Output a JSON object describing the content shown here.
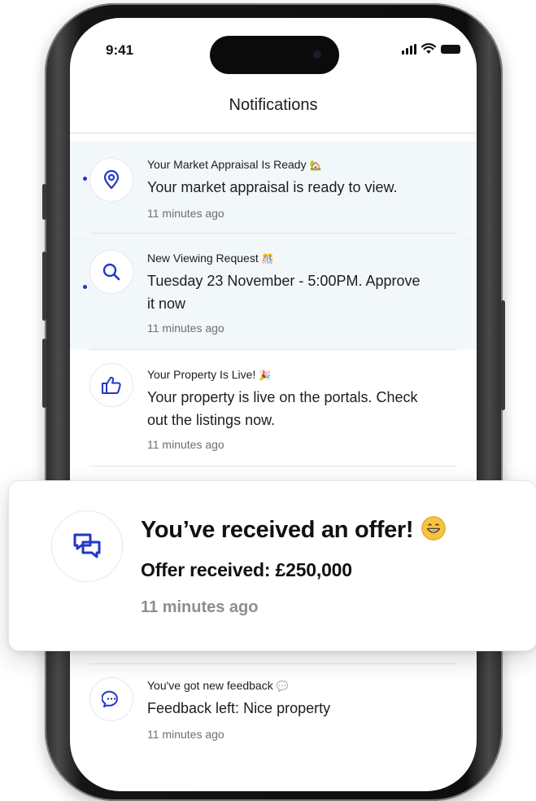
{
  "status_bar": {
    "time": "9:41"
  },
  "header": {
    "title": "Notifications"
  },
  "notifications": [
    {
      "title": "Your Market Appraisal Is Ready",
      "title_emoji": "🏡",
      "body": "Your market appraisal is ready to view.",
      "time": "11 minutes ago",
      "icon": "location-pin-icon",
      "unread": true
    },
    {
      "title": "New Viewing Request",
      "title_emoji": "🎊",
      "body_line1": "Tuesday 23 November - 5:00PM. Approve",
      "body_line2": "it now",
      "time": "11 minutes ago",
      "icon": "search-icon",
      "unread": true
    },
    {
      "title": "Your Property Is Live!",
      "title_emoji": "🎉",
      "body_line1": "Your property is live on the portals. Check",
      "body_line2": "out the listings now.",
      "time": "11 minutes ago",
      "icon": "thumbs-up-icon",
      "unread": false
    },
    {
      "title": "You've got new feedback",
      "title_emoji": "💬",
      "body": "Feedback left: Nice property",
      "time": "11 minutes ago",
      "icon": "chat-bubble-icon",
      "unread": false
    }
  ],
  "highlight_card": {
    "title": "You’ve received an offer!",
    "emoji": "grinning-face-icon",
    "body": "Offer received: £250,000",
    "time": "11 minutes ago",
    "icon": "chat-bubbles-icon"
  },
  "colors": {
    "accent": "#2236c9",
    "unread_bg": "#f2f7fa"
  }
}
